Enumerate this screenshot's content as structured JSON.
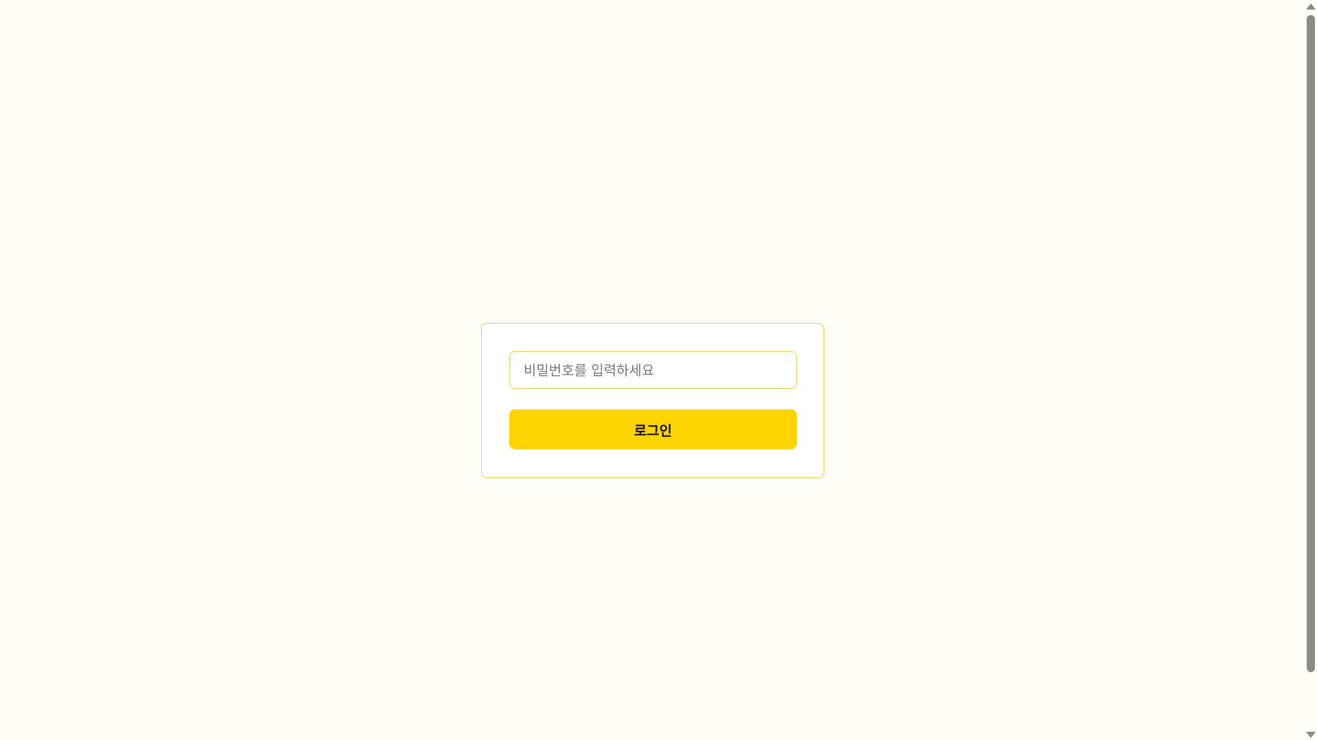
{
  "login": {
    "password_placeholder": "비밀번호를 입력하세요",
    "button_label": "로그인"
  },
  "colors": {
    "page_background": "#FFFDF5",
    "card_border": "#F2C94C",
    "button_background": "#FFD400"
  }
}
